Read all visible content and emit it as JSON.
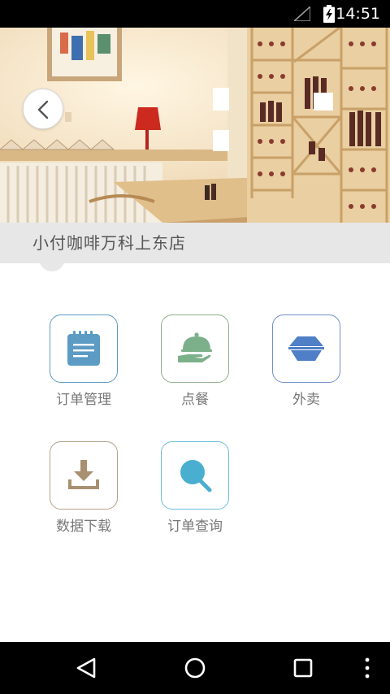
{
  "status_bar": {
    "time": "14:51",
    "icons": [
      "signal-icon",
      "battery-charging-icon"
    ]
  },
  "header": {
    "back_icon": "chevron-left-icon"
  },
  "store": {
    "name": "小付咖啡万科上东店"
  },
  "menu": {
    "items": [
      {
        "label": "订单管理",
        "icon": "order-list-icon",
        "border_color": "#5b9bc4",
        "icon_color": "#5b9bc4"
      },
      {
        "label": "点餐",
        "icon": "serving-dish-icon",
        "border_color": "#8db08d",
        "icon_color": "#7bb08a"
      },
      {
        "label": "外卖",
        "icon": "takeaway-box-icon",
        "border_color": "#6f8fc8",
        "icon_color": "#4f7fc6"
      },
      {
        "label": "数据下载",
        "icon": "download-icon",
        "border_color": "#b6a28a",
        "icon_color": "#a89070"
      },
      {
        "label": "订单查询",
        "icon": "search-icon",
        "border_color": "#6cbfd6",
        "icon_color": "#4aaed0"
      }
    ]
  },
  "nav_bar": {
    "items": [
      "back-triangle-icon",
      "home-circle-icon",
      "recents-square-icon",
      "more-vert-icon"
    ]
  }
}
